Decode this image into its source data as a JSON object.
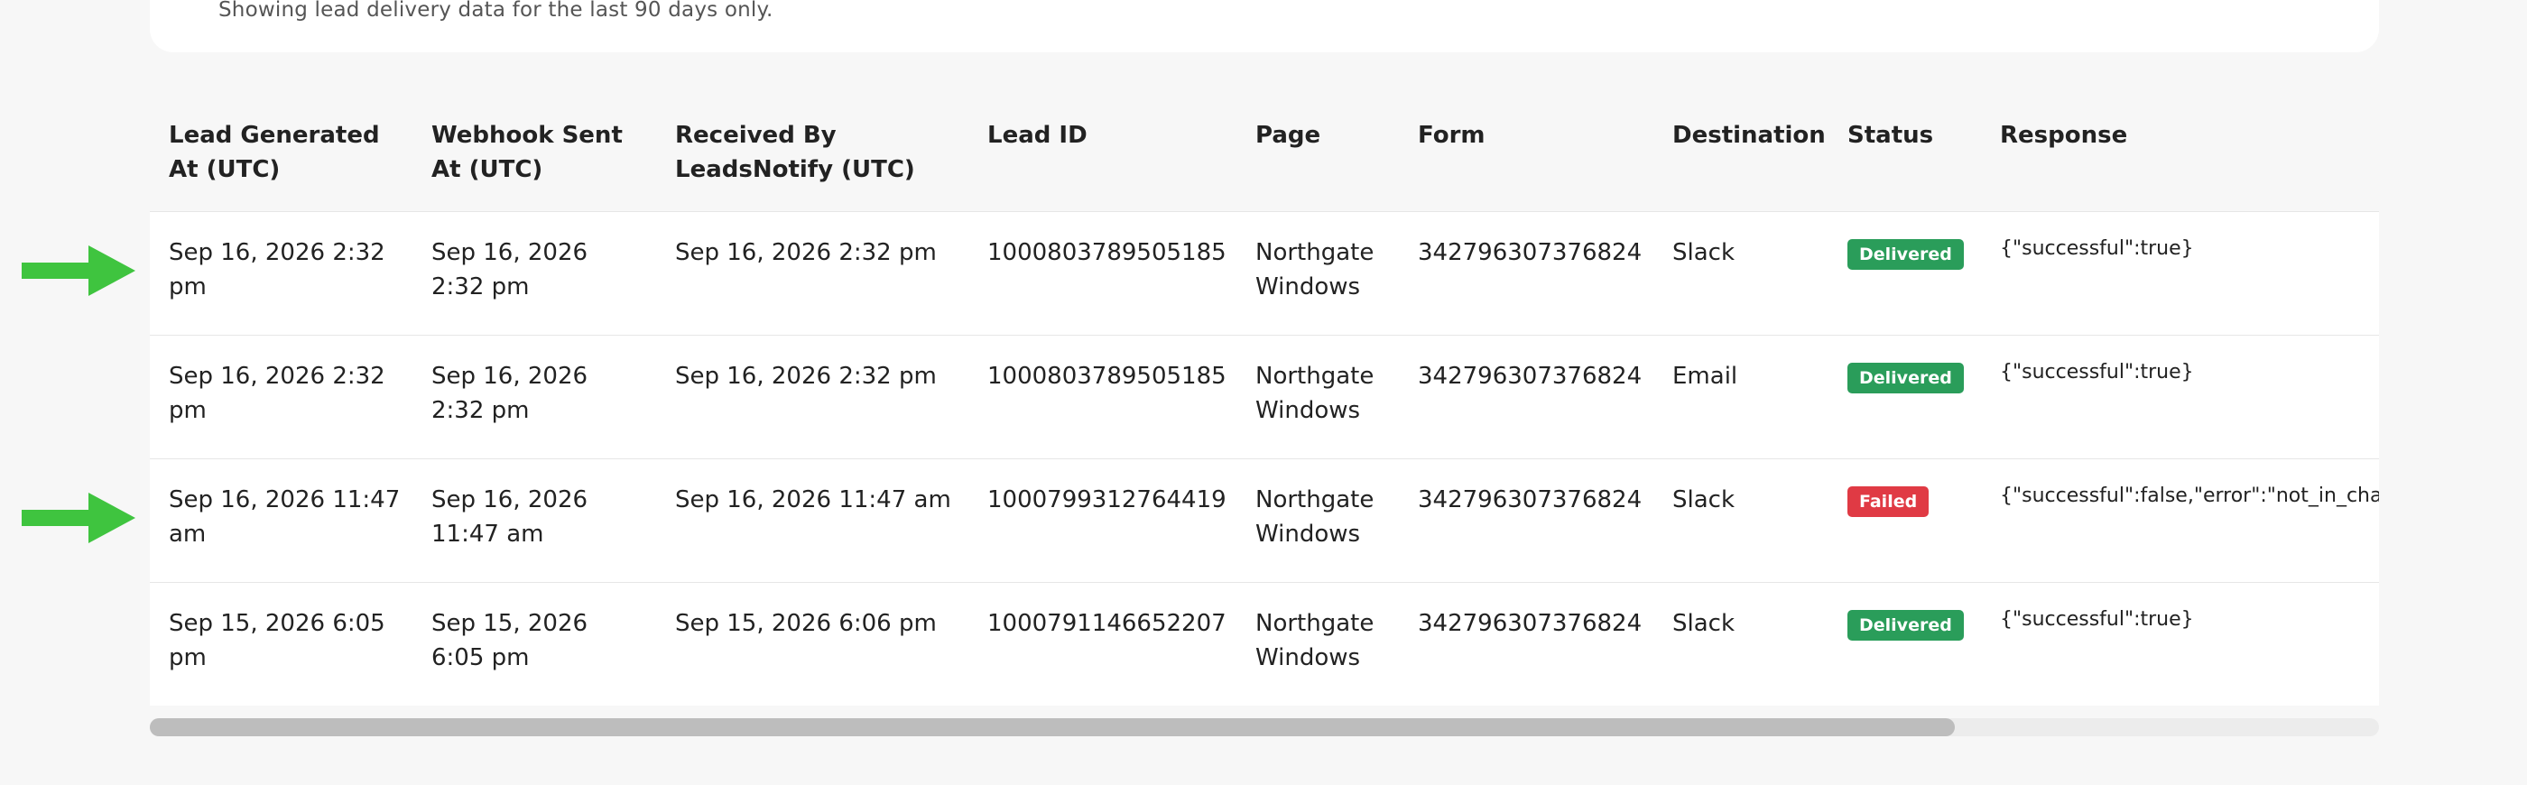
{
  "info": {
    "text": "Showing lead delivery data for the last 90 days only."
  },
  "table": {
    "headers": [
      "Lead Generated At (UTC)",
      "Webhook Sent At (UTC)",
      "Received By LeadsNotify (UTC)",
      "Lead ID",
      "Page",
      "Form",
      "Destination",
      "Status",
      "Response"
    ],
    "rows": [
      {
        "generated": "Sep 16, 2026 2:32 pm",
        "sent": "Sep 16, 2026 2:32 pm",
        "received": "Sep 16, 2026 2:32 pm",
        "lead_id": "1000803789505185",
        "page": "Northgate Windows",
        "form": "342796307376824",
        "destination": "Slack",
        "status": "Delivered",
        "response": "{\"successful\":true}"
      },
      {
        "generated": "Sep 16, 2026 2:32 pm",
        "sent": "Sep 16, 2026 2:32 pm",
        "received": "Sep 16, 2026 2:32 pm",
        "lead_id": "1000803789505185",
        "page": "Northgate Windows",
        "form": "342796307376824",
        "destination": "Email",
        "status": "Delivered",
        "response": "{\"successful\":true}"
      },
      {
        "generated": "Sep 16, 2026 11:47 am",
        "sent": "Sep 16, 2026 11:47 am",
        "received": "Sep 16, 2026 11:47 am",
        "lead_id": "1000799312764419",
        "page": "Northgate Windows",
        "form": "342796307376824",
        "destination": "Slack",
        "status": "Failed",
        "response": "{\"successful\":false,\"error\":\"not_in_channel\"}"
      },
      {
        "generated": "Sep 15, 2026 6:05 pm",
        "sent": "Sep 15, 2026 6:05 pm",
        "received": "Sep 15, 2026 6:06 pm",
        "lead_id": "1000791146652207",
        "page": "Northgate Windows",
        "form": "342796307376824",
        "destination": "Slack",
        "status": "Delivered",
        "response": "{\"successful\":true}"
      }
    ]
  },
  "colors": {
    "delivered": "#2a9d5a",
    "failed": "#e03a44",
    "arrow": "#3fc43f"
  },
  "icons": {
    "row_marker": "arrow-right-icon"
  },
  "scroll": {
    "horizontal_position_fraction": 0.0,
    "visible_fraction": 0.81
  }
}
